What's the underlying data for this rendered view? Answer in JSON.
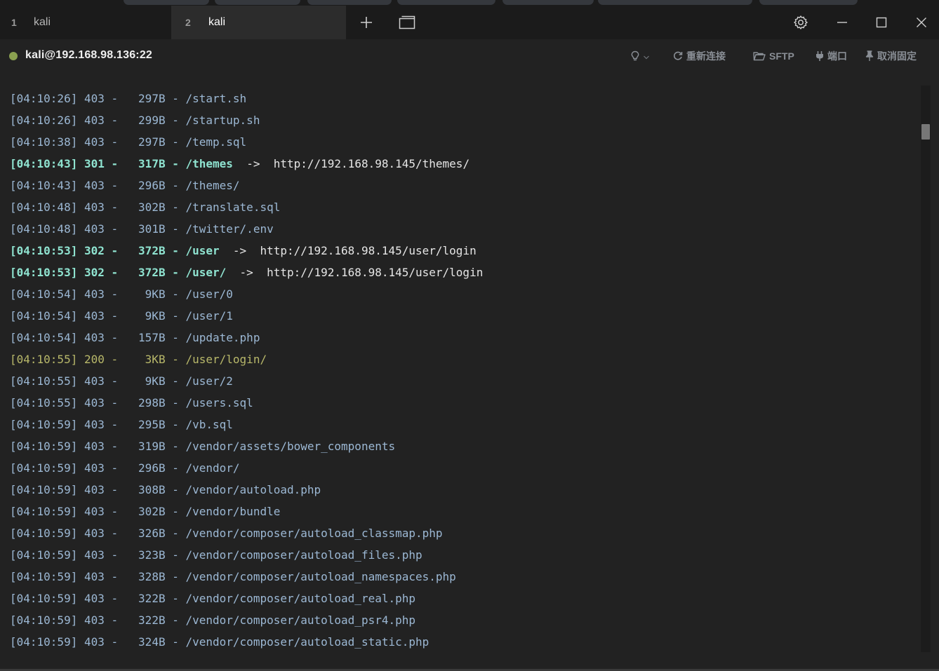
{
  "tabs": [
    {
      "number": "1",
      "title": "kali",
      "active": false
    },
    {
      "number": "2",
      "title": "kali",
      "active": true
    }
  ],
  "toolbar_icons": {
    "new_tab": "plus-icon",
    "duplicate": "windows-icon",
    "settings": "gear-icon",
    "minimize": "minimize-icon",
    "maximize": "maximize-icon",
    "close": "close-icon"
  },
  "connection": {
    "host": "kali@192.168.98.136:22",
    "status_color": "#8aa050"
  },
  "actions": {
    "reconnect": "重新连接",
    "sftp": "SFTP",
    "port": "端口",
    "unpin": "取消固定"
  },
  "colors": {
    "status_403": "#9cb8d4",
    "status_30x": "#8fe3d0",
    "status_200": "#b8b86a",
    "background": "#222222"
  },
  "terminal": {
    "lines": [
      {
        "time": "[04:10:26]",
        "code": "403",
        "size": "297B",
        "path": "/start.sh",
        "target": ""
      },
      {
        "time": "[04:10:26]",
        "code": "403",
        "size": "299B",
        "path": "/startup.sh",
        "target": ""
      },
      {
        "time": "[04:10:38]",
        "code": "403",
        "size": "297B",
        "path": "/temp.sql",
        "target": ""
      },
      {
        "time": "[04:10:43]",
        "code": "301",
        "size": "317B",
        "path": "/themes",
        "target": "http://192.168.98.145/themes/"
      },
      {
        "time": "[04:10:43]",
        "code": "403",
        "size": "296B",
        "path": "/themes/",
        "target": ""
      },
      {
        "time": "[04:10:48]",
        "code": "403",
        "size": "302B",
        "path": "/translate.sql",
        "target": ""
      },
      {
        "time": "[04:10:48]",
        "code": "403",
        "size": "301B",
        "path": "/twitter/.env",
        "target": ""
      },
      {
        "time": "[04:10:53]",
        "code": "302",
        "size": "372B",
        "path": "/user",
        "target": "http://192.168.98.145/user/login"
      },
      {
        "time": "[04:10:53]",
        "code": "302",
        "size": "372B",
        "path": "/user/",
        "target": "http://192.168.98.145/user/login"
      },
      {
        "time": "[04:10:54]",
        "code": "403",
        "size": "9KB",
        "path": "/user/0",
        "target": ""
      },
      {
        "time": "[04:10:54]",
        "code": "403",
        "size": "9KB",
        "path": "/user/1",
        "target": ""
      },
      {
        "time": "[04:10:54]",
        "code": "403",
        "size": "157B",
        "path": "/update.php",
        "target": ""
      },
      {
        "time": "[04:10:55]",
        "code": "200",
        "size": "3KB",
        "path": "/user/login/",
        "target": ""
      },
      {
        "time": "[04:10:55]",
        "code": "403",
        "size": "9KB",
        "path": "/user/2",
        "target": ""
      },
      {
        "time": "[04:10:55]",
        "code": "403",
        "size": "298B",
        "path": "/users.sql",
        "target": ""
      },
      {
        "time": "[04:10:59]",
        "code": "403",
        "size": "295B",
        "path": "/vb.sql",
        "target": ""
      },
      {
        "time": "[04:10:59]",
        "code": "403",
        "size": "319B",
        "path": "/vendor/assets/bower_components",
        "target": ""
      },
      {
        "time": "[04:10:59]",
        "code": "403",
        "size": "296B",
        "path": "/vendor/",
        "target": ""
      },
      {
        "time": "[04:10:59]",
        "code": "403",
        "size": "308B",
        "path": "/vendor/autoload.php",
        "target": ""
      },
      {
        "time": "[04:10:59]",
        "code": "403",
        "size": "302B",
        "path": "/vendor/bundle",
        "target": ""
      },
      {
        "time": "[04:10:59]",
        "code": "403",
        "size": "326B",
        "path": "/vendor/composer/autoload_classmap.php",
        "target": ""
      },
      {
        "time": "[04:10:59]",
        "code": "403",
        "size": "323B",
        "path": "/vendor/composer/autoload_files.php",
        "target": ""
      },
      {
        "time": "[04:10:59]",
        "code": "403",
        "size": "328B",
        "path": "/vendor/composer/autoload_namespaces.php",
        "target": ""
      },
      {
        "time": "[04:10:59]",
        "code": "403",
        "size": "322B",
        "path": "/vendor/composer/autoload_real.php",
        "target": ""
      },
      {
        "time": "[04:10:59]",
        "code": "403",
        "size": "322B",
        "path": "/vendor/composer/autoload_psr4.php",
        "target": ""
      },
      {
        "time": "[04:10:59]",
        "code": "403",
        "size": "324B",
        "path": "/vendor/composer/autoload_static.php",
        "target": ""
      }
    ]
  }
}
